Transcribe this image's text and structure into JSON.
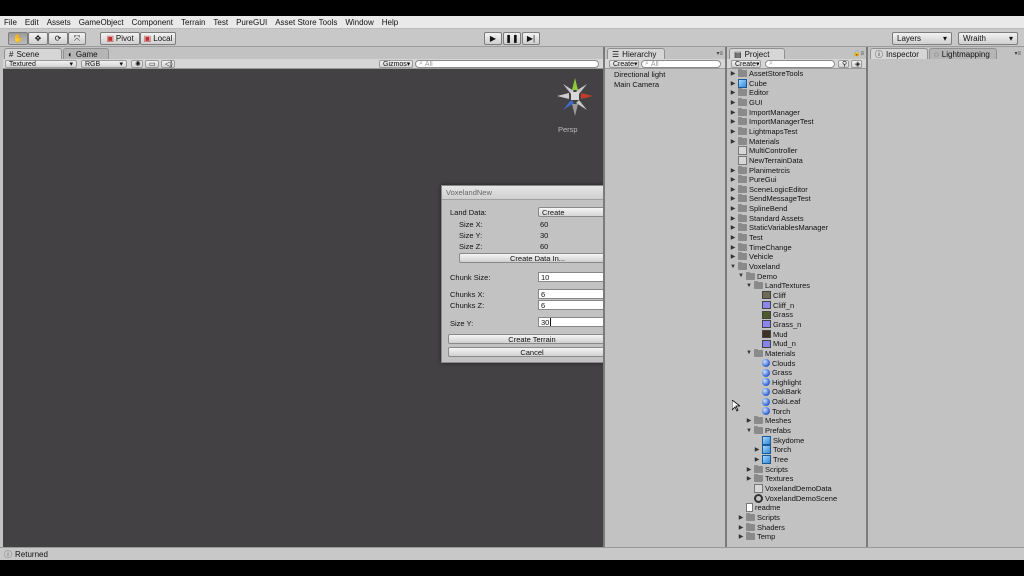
{
  "menu": [
    "File",
    "Edit",
    "Assets",
    "GameObject",
    "Component",
    "Terrain",
    "Test",
    "PureGUI",
    "Asset Store Tools",
    "Window",
    "Help"
  ],
  "toolbar": {
    "pivot_label": "Pivot",
    "local_label": "Local",
    "layers_label": "Layers",
    "layout_label": "Wraith"
  },
  "scene": {
    "tab_scene": "Scene",
    "tab_game": "Game",
    "render_mode": "Textured",
    "color_mode": "RGB",
    "gizmos_label": "Gizmos",
    "search_placeholder": "All",
    "persp_label": "Persp"
  },
  "hierarchy": {
    "title": "Hierarchy",
    "create_label": "Create",
    "search_placeholder": "All",
    "items": [
      "Directional light",
      "Main Camera"
    ]
  },
  "project": {
    "title": "Project",
    "create_label": "Create",
    "items": [
      {
        "label": "AssetStoreTools",
        "depth": 0,
        "icon": "folder",
        "arrow": "right"
      },
      {
        "label": "Cube",
        "depth": 0,
        "icon": "cube",
        "arrow": "right"
      },
      {
        "label": "Editor",
        "depth": 0,
        "icon": "folder",
        "arrow": "right"
      },
      {
        "label": "GUI",
        "depth": 0,
        "icon": "folder",
        "arrow": "right"
      },
      {
        "label": "ImportManager",
        "depth": 0,
        "icon": "folder",
        "arrow": "right"
      },
      {
        "label": "ImportManagerTest",
        "depth": 0,
        "icon": "folder",
        "arrow": "right"
      },
      {
        "label": "LightmapsTest",
        "depth": 0,
        "icon": "folder",
        "arrow": "right"
      },
      {
        "label": "Materials",
        "depth": 0,
        "icon": "folder",
        "arrow": "right"
      },
      {
        "label": "MultiController",
        "depth": 0,
        "icon": "script",
        "arrow": ""
      },
      {
        "label": "NewTerrainData",
        "depth": 0,
        "icon": "script",
        "arrow": ""
      },
      {
        "label": "Planimetrcis",
        "depth": 0,
        "icon": "folder",
        "arrow": "right"
      },
      {
        "label": "PureGui",
        "depth": 0,
        "icon": "folder",
        "arrow": "right"
      },
      {
        "label": "SceneLogicEditor",
        "depth": 0,
        "icon": "folder",
        "arrow": "right"
      },
      {
        "label": "SendMessageTest",
        "depth": 0,
        "icon": "folder",
        "arrow": "right"
      },
      {
        "label": "SplineBend",
        "depth": 0,
        "icon": "folder",
        "arrow": "right"
      },
      {
        "label": "Standard Assets",
        "depth": 0,
        "icon": "folder",
        "arrow": "right"
      },
      {
        "label": "StaticVariablesManager",
        "depth": 0,
        "icon": "folder",
        "arrow": "right"
      },
      {
        "label": "Test",
        "depth": 0,
        "icon": "folder",
        "arrow": "right"
      },
      {
        "label": "TimeChange",
        "depth": 0,
        "icon": "folder",
        "arrow": "right"
      },
      {
        "label": "Vehicle",
        "depth": 0,
        "icon": "folder",
        "arrow": "right"
      },
      {
        "label": "Voxeland",
        "depth": 0,
        "icon": "folder",
        "arrow": "down"
      },
      {
        "label": "Demo",
        "depth": 1,
        "icon": "folder",
        "arrow": "down"
      },
      {
        "label": "LandTextures",
        "depth": 2,
        "icon": "folder",
        "arrow": "down"
      },
      {
        "label": "Cliff",
        "depth": 3,
        "icon": "tex",
        "color": "#6e6a58",
        "arrow": ""
      },
      {
        "label": "Cliff_n",
        "depth": 3,
        "icon": "tex",
        "color": "#8b86f0",
        "arrow": ""
      },
      {
        "label": "Grass",
        "depth": 3,
        "icon": "tex",
        "color": "#4d5a2a",
        "arrow": ""
      },
      {
        "label": "Grass_n",
        "depth": 3,
        "icon": "tex",
        "color": "#8a85f2",
        "arrow": ""
      },
      {
        "label": "Mud",
        "depth": 3,
        "icon": "tex",
        "color": "#3e3224",
        "arrow": ""
      },
      {
        "label": "Mud_n",
        "depth": 3,
        "icon": "tex",
        "color": "#8682ef",
        "arrow": ""
      },
      {
        "label": "Materials",
        "depth": 2,
        "icon": "folder",
        "arrow": "down"
      },
      {
        "label": "Clouds",
        "depth": 3,
        "icon": "sphere",
        "arrow": ""
      },
      {
        "label": "Grass",
        "depth": 3,
        "icon": "sphere",
        "arrow": ""
      },
      {
        "label": "Highlight",
        "depth": 3,
        "icon": "sphere",
        "arrow": ""
      },
      {
        "label": "OakBark",
        "depth": 3,
        "icon": "sphere",
        "arrow": ""
      },
      {
        "label": "OakLeaf",
        "depth": 3,
        "icon": "sphere",
        "arrow": ""
      },
      {
        "label": "Torch",
        "depth": 3,
        "icon": "sphere",
        "arrow": ""
      },
      {
        "label": "Meshes",
        "depth": 2,
        "icon": "folder",
        "arrow": "right"
      },
      {
        "label": "Prefabs",
        "depth": 2,
        "icon": "folder",
        "arrow": "down"
      },
      {
        "label": "Skydome",
        "depth": 3,
        "icon": "cube",
        "arrow": ""
      },
      {
        "label": "Torch",
        "depth": 3,
        "icon": "cube",
        "arrow": "right"
      },
      {
        "label": "Tree",
        "depth": 3,
        "icon": "cube",
        "arrow": "right"
      },
      {
        "label": "Scripts",
        "depth": 2,
        "icon": "folder",
        "arrow": "right"
      },
      {
        "label": "Textures",
        "depth": 2,
        "icon": "folder",
        "arrow": "right"
      },
      {
        "label": "VoxelandDemoData",
        "depth": 2,
        "icon": "script",
        "arrow": ""
      },
      {
        "label": "VoxelandDemoScene",
        "depth": 2,
        "icon": "unity",
        "arrow": ""
      },
      {
        "label": "readme",
        "depth": 1,
        "icon": "doc",
        "arrow": ""
      },
      {
        "label": "Scripts",
        "depth": 1,
        "icon": "folder",
        "arrow": "right"
      },
      {
        "label": "Shaders",
        "depth": 1,
        "icon": "folder",
        "arrow": "right"
      },
      {
        "label": "Temp",
        "depth": 1,
        "icon": "folder",
        "arrow": "right"
      }
    ]
  },
  "inspector": {
    "tab_inspector": "Inspector",
    "tab_lightmapping": "Lightmapping"
  },
  "dialog": {
    "title": "VoxelandNew",
    "land_data_label": "Land Data:",
    "land_data_value": "Create",
    "size_x_label": "Size X:",
    "size_x_value": "60",
    "size_y_label": "Size Y:",
    "size_y_value": "30",
    "size_z_label": "Size Z:",
    "size_z_value": "60",
    "create_data_in_label": "Create Data In...",
    "chunk_size_label": "Chunk Size:",
    "chunk_size_value": "10",
    "chunks_x_label": "Chunks X:",
    "chunks_x_value": "6",
    "chunks_z_label": "Chunks Z:",
    "chunks_z_value": "6",
    "size_y2_label": "Size Y:",
    "size_y2_value": "30",
    "create_terrain_label": "Create Terrain",
    "cancel_label": "Cancel"
  },
  "status": {
    "text": "Returned"
  }
}
